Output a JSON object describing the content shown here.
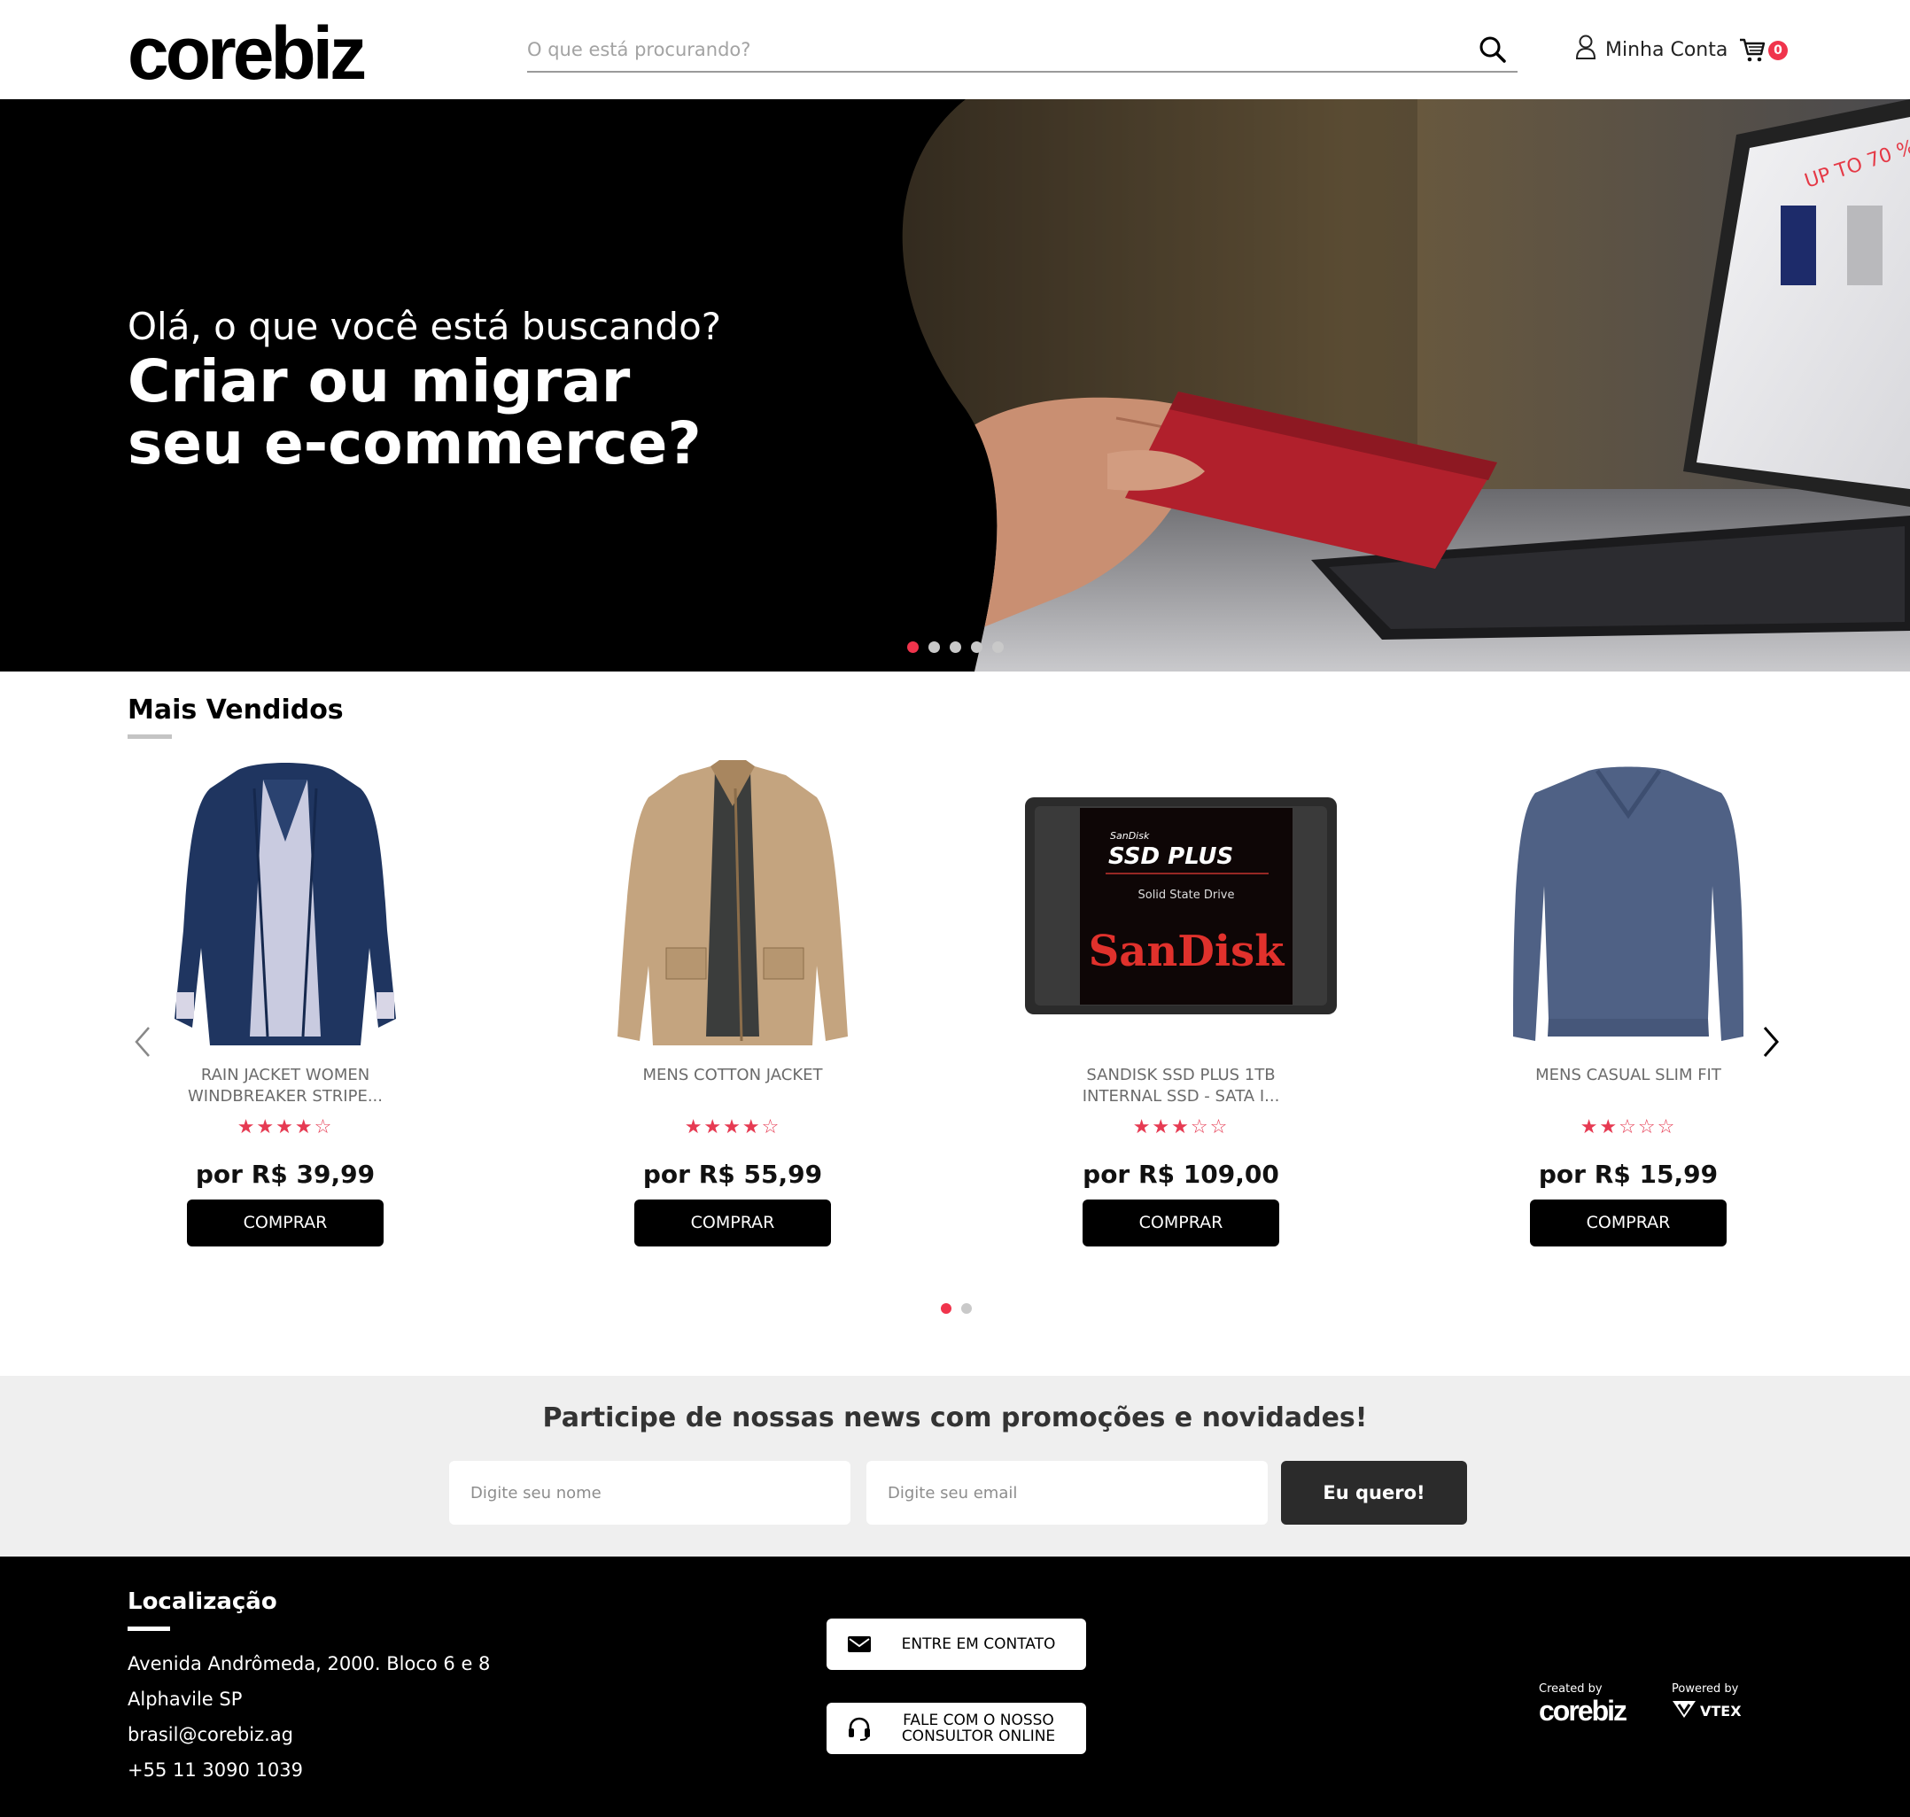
{
  "header": {
    "logo": "corebiz",
    "search_placeholder": "O que está procurando?",
    "account_label": "Minha Conta",
    "cart_count": "0"
  },
  "hero": {
    "subtitle": "Olá, o que você está buscando?",
    "title": "Criar ou migrar seu e-commerce?",
    "slides": 5,
    "active_slide": 1,
    "accent_color": "#f0344c"
  },
  "shelf": {
    "title": "Mais Vendidos",
    "buy_label": "COMPRAR",
    "pages": 2,
    "active_page": 1,
    "products": [
      {
        "name": "RAIN JACKET WOMEN WINDBREAKER STRIPE...",
        "rating": 4,
        "stars": "★★★★☆",
        "price": "por R$ 39,99",
        "image": "navy-rain-jacket"
      },
      {
        "name": "MENS COTTON JACKET",
        "rating": 4.5,
        "stars": "★★★★☆",
        "price": "por R$ 55,99",
        "image": "beige-cotton-jacket"
      },
      {
        "name": "SANDISK SSD PLUS 1TB INTERNAL SSD - SATA I...",
        "rating": 3,
        "stars": "★★★☆☆",
        "price": "por R$ 109,00",
        "image": "sandisk-ssd"
      },
      {
        "name": "MENS CASUAL SLIM FIT",
        "rating": 2,
        "stars": "★★☆☆☆",
        "price": "por R$ 15,99",
        "image": "blue-long-sleeve-shirt"
      }
    ],
    "ssd_label": {
      "brand_small": "SanDisk",
      "model": "SSD PLUS",
      "caption": "Solid State Drive",
      "brand": "SanDisk"
    }
  },
  "newsletter": {
    "title": "Participe de nossas news com promoções e novidades!",
    "name_placeholder": "Digite seu nome",
    "email_placeholder": "Digite seu email",
    "submit_label": "Eu quero!"
  },
  "footer": {
    "location_title": "Localização",
    "address_line1": "Avenida Andrômeda, 2000. Bloco 6 e 8",
    "address_line2": "Alphavile SP",
    "email": "brasil@corebiz.ag",
    "phone": "+55 11 3090 1039",
    "contact_label": "ENTRE EM CONTATO",
    "consultant_label": "FALE COM O NOSSO CONSULTOR ONLINE",
    "created_by": "Created by",
    "created_brand": "corebiz",
    "powered_by": "Powered by",
    "powered_brand": "VTEX"
  }
}
